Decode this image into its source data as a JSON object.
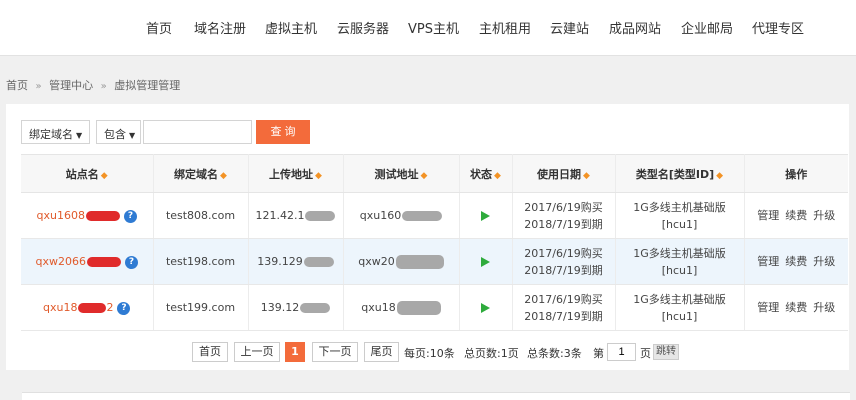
{
  "topnav": [
    "首页",
    "域名注册",
    "虚拟主机",
    "云服务器",
    "VPS主机",
    "主机租用",
    "云建站",
    "成品网站",
    "企业邮局",
    "代理专区"
  ],
  "breadcrumb": [
    "首页",
    "管理中心",
    "虚拟管理管理"
  ],
  "filter": {
    "field_select": "绑定域名",
    "mode_select": "包含",
    "keyword_value": "",
    "search_label": "查 询"
  },
  "table": {
    "headers": [
      "站点名",
      "绑定域名",
      "上传地址",
      "测试地址",
      "状态",
      "使用日期",
      "类型名[类型ID]",
      "操作"
    ],
    "rows": [
      {
        "site": "qxu1608",
        "domain": "test808.com",
        "upload": "121.42.1",
        "test_addr": "qxu160",
        "date_buy": "2017/6/19购买",
        "date_expire": "2018/7/19到期",
        "type_name": "1G多线主机基础版",
        "type_id": "[hcu1]"
      },
      {
        "site": "qxw2066",
        "domain": "test198.com",
        "upload": "139.129",
        "test_addr": "qxw20",
        "date_buy": "2017/6/19购买",
        "date_expire": "2018/7/19到期",
        "type_name": "1G多线主机基础版",
        "type_id": "[hcu1]"
      },
      {
        "site": "qxu18",
        "site_tail": "2",
        "domain": "test199.com",
        "upload": "139.12",
        "test_addr": "qxu18",
        "date_buy": "2017/6/19购买",
        "date_expire": "2018/7/19到期",
        "type_name": "1G多线主机基础版",
        "type_id": "[hcu1]"
      }
    ],
    "ops": [
      "管理",
      "续费",
      "升级"
    ]
  },
  "pager": {
    "first": "首页",
    "prev": "上一页",
    "current": "1",
    "next": "下一页",
    "last": "尾页",
    "per_page": "每页:10条",
    "total_pages": "总页数:1页",
    "total_items": "总条数:3条",
    "page_prefix": "第",
    "page_value": "1",
    "page_suffix": "页",
    "go": "跳转"
  },
  "colors": {
    "accent": "#f36b3b",
    "sort_arrow": "#f39325",
    "status_ok": "#2eab3c",
    "link_site": "#e05a2b",
    "help_icon": "#2f7bd3",
    "row_highlight": "#edf5fc"
  },
  "icons": {
    "sort": "sort-arrows-icon",
    "help": "question-circle-icon",
    "status": "play-triangle-icon",
    "breadcrumb_sep": "chevron-right-icon",
    "select": "caret-down-icon"
  }
}
